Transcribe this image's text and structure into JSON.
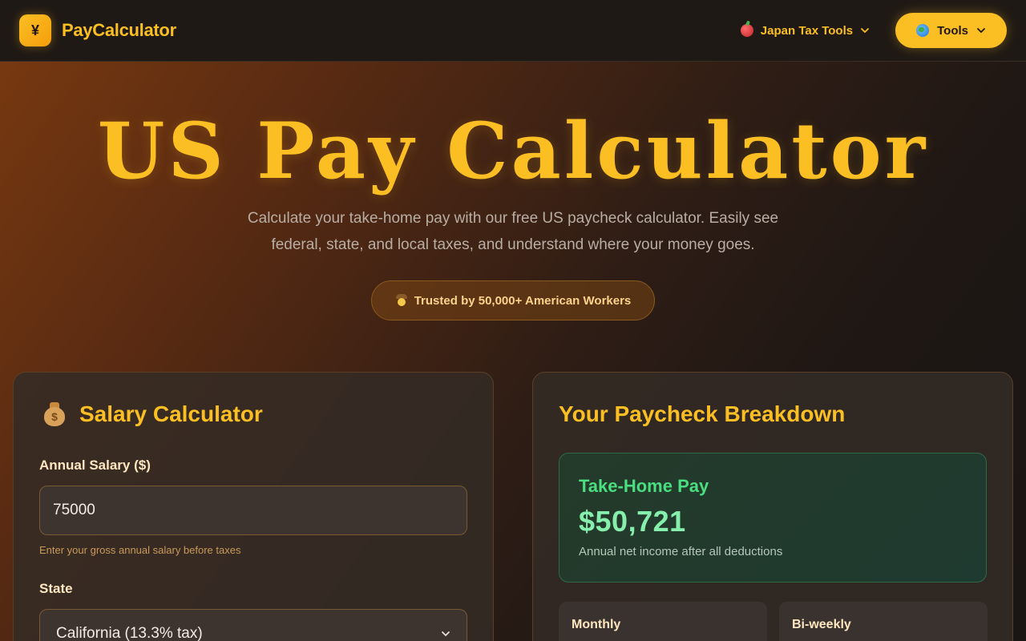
{
  "header": {
    "logo_glyph": "¥",
    "brand": "PayCalculator",
    "nav_link": "Japan Tax Tools",
    "tools_button": "Tools"
  },
  "hero": {
    "title": "US Pay Calculator",
    "subtitle": "Calculate your take-home pay with our free US paycheck calculator. Easily see federal, state, and local taxes, and understand where your money goes.",
    "badge": "Trusted by 50,000+ American Workers"
  },
  "calculator": {
    "title": "Salary Calculator",
    "salary_label": "Annual Salary ($)",
    "salary_value": "75000",
    "salary_hint": "Enter your gross annual salary before taxes",
    "state_label": "State",
    "state_value": "California (13.3% tax)"
  },
  "breakdown": {
    "title": "Your Paycheck Breakdown",
    "takehome_label": "Take-Home Pay",
    "takehome_value": "$50,721",
    "takehome_sub": "Annual net income after all deductions",
    "period_monthly": "Monthly",
    "period_biweekly": "Bi-weekly"
  },
  "colors": {
    "accent": "#fbbf24",
    "success": "#4ade80",
    "background": "#1c1714"
  },
  "icons": {
    "logo": "yen-logo-icon",
    "japan": "apple-icon",
    "tools": "globe-icon",
    "badge": "cowboy-icon",
    "calculator": "money-bag-icon"
  }
}
